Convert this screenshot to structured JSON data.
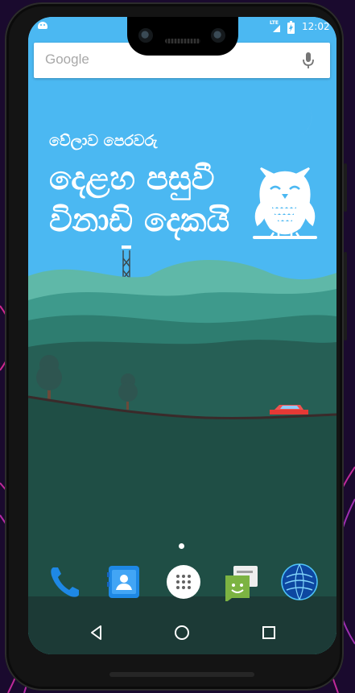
{
  "status_bar": {
    "network": "LTE",
    "time": "12:02"
  },
  "search": {
    "logo": "Google",
    "icon": "mic-icon"
  },
  "clock_widget": {
    "prefix": "වේලාව පෙරවරු",
    "line1": "දෙළහ පසුවී",
    "line2": "විනාඩි දෙකයි"
  },
  "dock": {
    "apps": [
      {
        "name": "phone",
        "icon": "phone-icon"
      },
      {
        "name": "contacts",
        "icon": "contacts-icon"
      },
      {
        "name": "app-drawer",
        "icon": "app-drawer-icon"
      },
      {
        "name": "messaging",
        "icon": "messaging-icon"
      },
      {
        "name": "browser",
        "icon": "globe-icon"
      }
    ]
  },
  "navigation": {
    "buttons": [
      "back",
      "home",
      "recents"
    ]
  },
  "colors": {
    "sky": "#4bb8f2",
    "hill_dark": "#1f4e45",
    "hill_light": "#3e9a8c",
    "text": "#ffffff"
  }
}
